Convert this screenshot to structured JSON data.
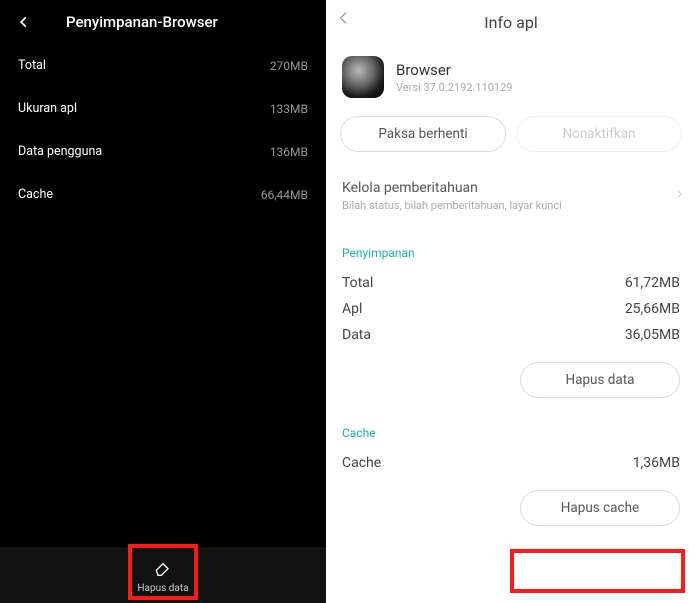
{
  "left": {
    "title": "Penyimpanan-Browser",
    "rows": [
      {
        "label": "Total",
        "value": "270MB"
      },
      {
        "label": "Ukuran apl",
        "value": "133MB"
      },
      {
        "label": "Data pengguna",
        "value": "136MB"
      },
      {
        "label": "Cache",
        "value": "66,44MB"
      }
    ],
    "clear_data": "Hapus data"
  },
  "right": {
    "title": "Info apl",
    "app_name": "Browser",
    "app_version": "Versi 37.0.2192.110129",
    "force_stop": "Paksa berhenti",
    "disable": "Nonaktifkan",
    "notif_title": "Kelola pemberitahuan",
    "notif_sub": "Bilah status, bilah pemberitahuan, layar kunci",
    "storage_header": "Penyimpanan",
    "storage_rows": [
      {
        "label": "Total",
        "value": "61,72MB"
      },
      {
        "label": "Apl",
        "value": "25,66MB"
      },
      {
        "label": "Data",
        "value": "36,05MB"
      }
    ],
    "clear_data": "Hapus data",
    "cache_header": "Cache",
    "cache_rows": [
      {
        "label": "Cache",
        "value": "1,36MB"
      }
    ],
    "clear_cache": "Hapus cache"
  }
}
